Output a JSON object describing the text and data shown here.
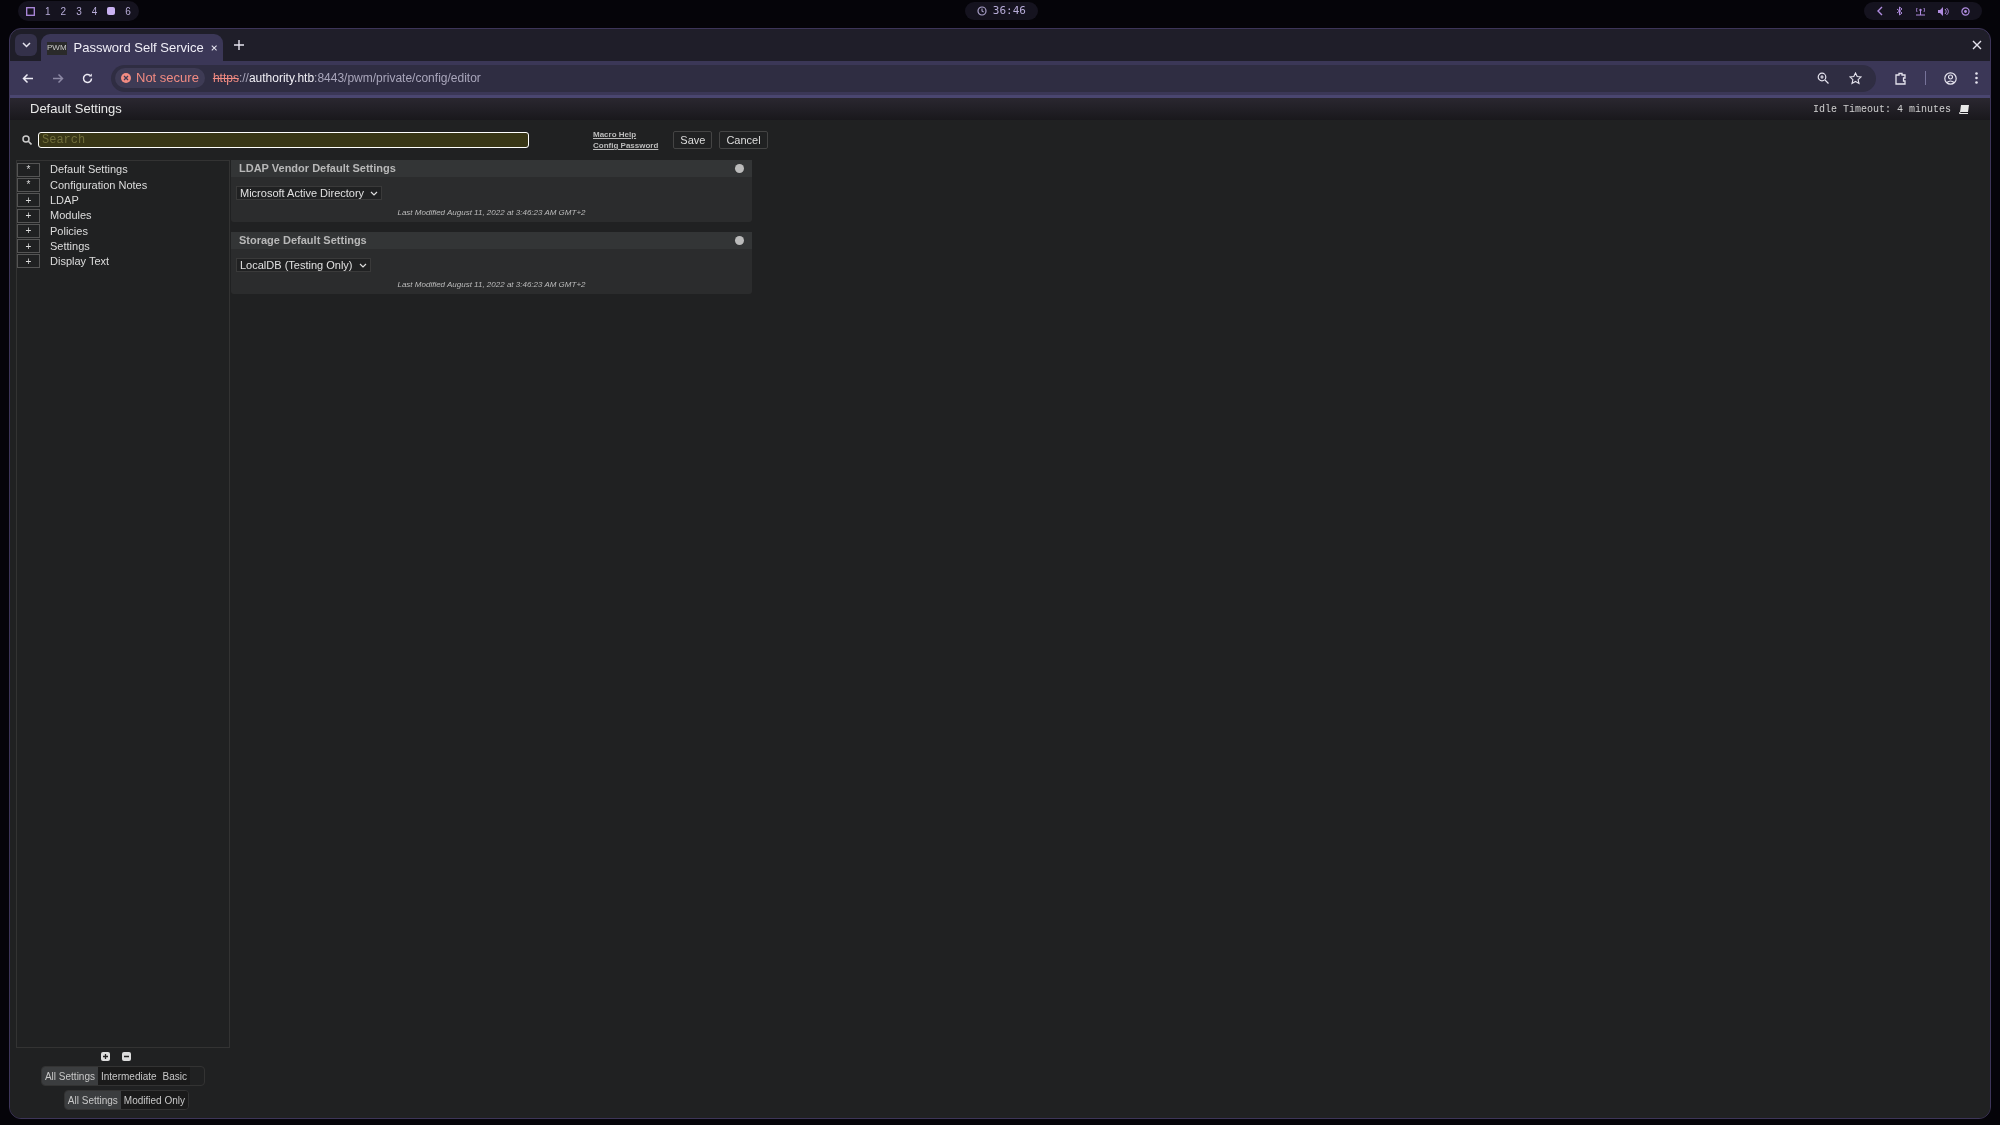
{
  "system_bar": {
    "workspaces": [
      {
        "kind": "layout"
      },
      {
        "kind": "number",
        "label": "1"
      },
      {
        "kind": "number",
        "label": "2"
      },
      {
        "kind": "number",
        "label": "3"
      },
      {
        "kind": "number",
        "label": "4"
      },
      {
        "kind": "active"
      },
      {
        "kind": "number",
        "label": "6"
      }
    ],
    "clock": "36:46"
  },
  "browser": {
    "tab": {
      "title": "Password Self Service",
      "favicon": "PWM"
    },
    "security": "Not secure",
    "url": {
      "scheme": "https",
      "sep": "://",
      "host": "authority.htb",
      "rest": ":8443/pwm/private/config/editor"
    }
  },
  "header": {
    "title": "Default Settings",
    "idle": "Idle Timeout: 4 minutes"
  },
  "search": {
    "placeholder": "Search"
  },
  "links": [
    "Macro Help",
    "Config Password"
  ],
  "buttons": [
    "Save",
    "Cancel"
  ],
  "tree": [
    {
      "symbol": "*",
      "label": "Default Settings"
    },
    {
      "symbol": "*",
      "label": "Configuration Notes"
    },
    {
      "symbol": "+",
      "label": "LDAP"
    },
    {
      "symbol": "+",
      "label": "Modules"
    },
    {
      "symbol": "+",
      "label": "Policies"
    },
    {
      "symbol": "+",
      "label": "Settings"
    },
    {
      "symbol": "+",
      "label": "Display Text"
    }
  ],
  "panels": [
    {
      "title": "LDAP Vendor Default Settings",
      "value": "Microsoft Active Directory",
      "modified": "Last Modified August 11, 2022 at 3:46:23 AM GMT+2"
    },
    {
      "title": "Storage Default Settings",
      "value": "LocalDB (Testing Only)",
      "modified": "Last Modified August 11, 2022 at 3:46:23 AM GMT+2"
    }
  ],
  "level_filter": [
    {
      "label": "All Settings",
      "selected": true
    },
    {
      "label": "Intermediate",
      "selected": false
    },
    {
      "label": "Basic",
      "selected": false
    }
  ],
  "modified_filter": [
    {
      "label": "All Settings",
      "selected": true
    },
    {
      "label": "Modified Only",
      "selected": false
    }
  ]
}
